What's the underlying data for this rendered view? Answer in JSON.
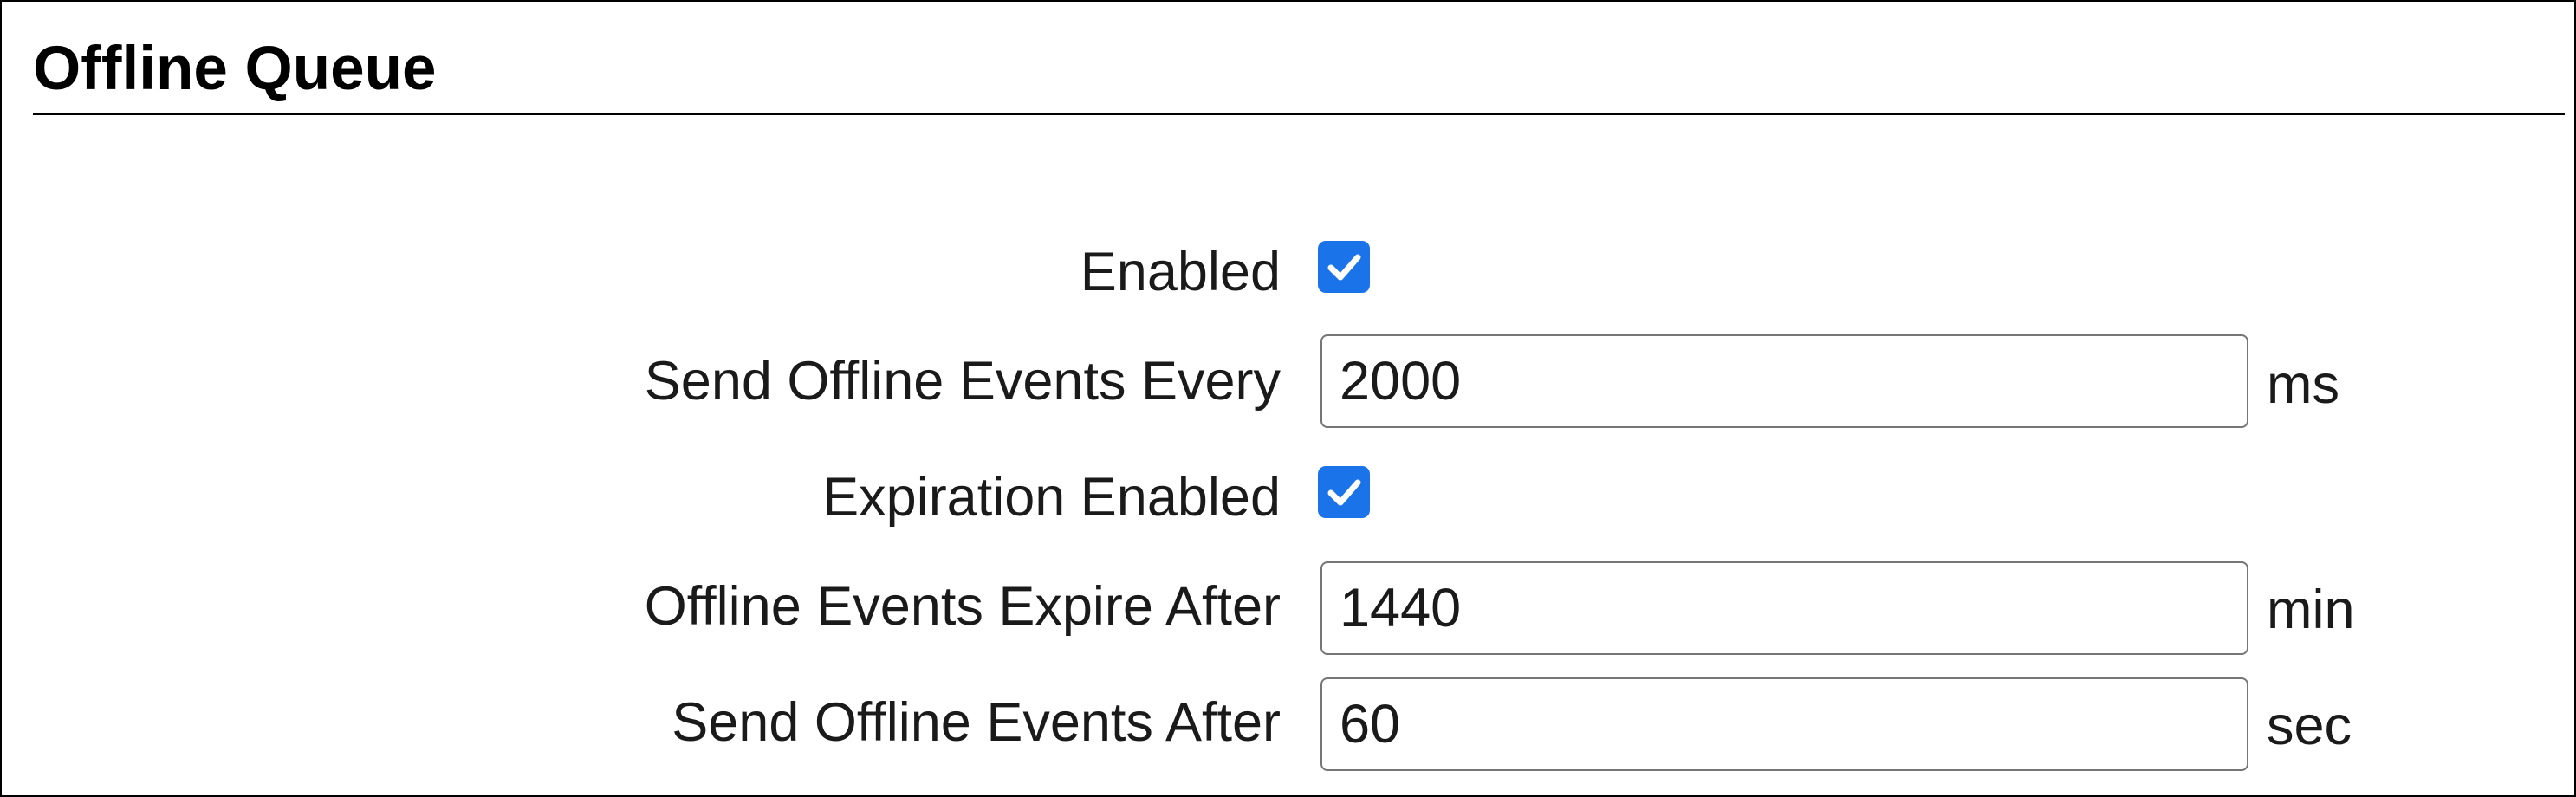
{
  "section": {
    "title": "Offline Queue"
  },
  "form": {
    "enabled": {
      "label": "Enabled",
      "checked": true
    },
    "send_every": {
      "label": "Send Offline Events Every",
      "value": "2000",
      "unit": "ms"
    },
    "expiration_enabled": {
      "label": "Expiration Enabled",
      "checked": true
    },
    "expire_after": {
      "label": "Offline Events Expire After",
      "value": "1440",
      "unit": "min"
    },
    "send_after": {
      "label": "Send Offline Events After",
      "value": "60",
      "unit": "sec"
    }
  },
  "colors": {
    "checkbox_accent": "#1a73e8",
    "border": "#767676",
    "text": "#1a1a1a"
  },
  "icons": {
    "checkmark": "check-icon"
  }
}
